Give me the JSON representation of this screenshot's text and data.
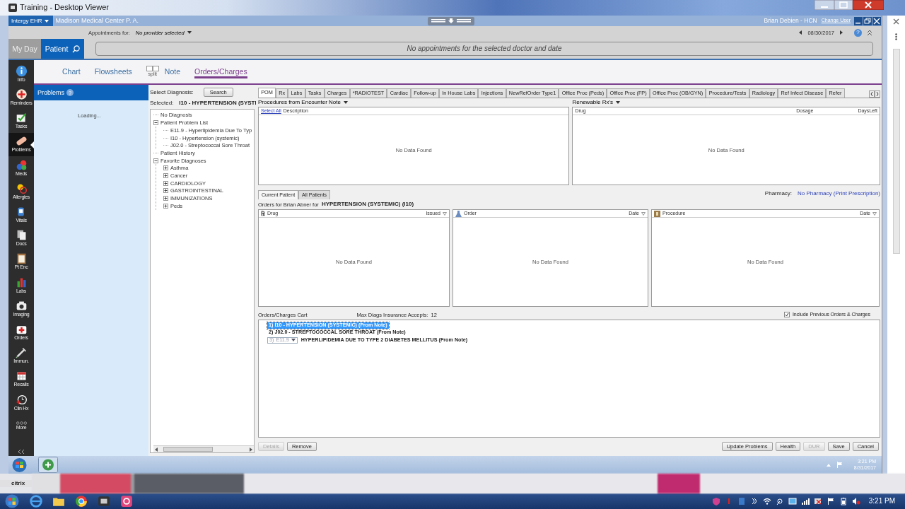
{
  "window": {
    "title": "Training - Desktop Viewer"
  },
  "app_bar": {
    "product": "Intergy EHR",
    "practice": "Madison Medical Center P. A.",
    "user": "Brian Debien - HCN",
    "change_user": "Change User"
  },
  "appointments": {
    "label": "Appointments for:",
    "provider": "No provider selected",
    "date": "08/30/2017",
    "help": "?",
    "message": "No appointments for the selected doctor and date"
  },
  "mode_tabs": [
    {
      "label": "My Day",
      "selected": false
    },
    {
      "label": "Patient",
      "selected": true
    }
  ],
  "sidebar": {
    "items": [
      {
        "label": "Info",
        "selected": false
      },
      {
        "label": "Reminders",
        "selected": false
      },
      {
        "label": "Tasks",
        "selected": false
      },
      {
        "label": "Problems",
        "selected": true
      },
      {
        "label": "Meds",
        "selected": false
      },
      {
        "label": "Allergies",
        "selected": false
      },
      {
        "label": "Vitals",
        "selected": false
      },
      {
        "label": "Docs",
        "selected": false
      },
      {
        "label": "Pt Enc",
        "selected": false
      },
      {
        "label": "Labs",
        "selected": false
      },
      {
        "label": "Imaging",
        "selected": false
      },
      {
        "label": "Orders",
        "selected": false
      },
      {
        "label": "Immun.",
        "selected": false
      },
      {
        "label": "Recalls",
        "selected": false
      },
      {
        "label": "Clin Hx",
        "selected": false
      },
      {
        "label": "More",
        "selected": false
      }
    ]
  },
  "view_tabs": [
    {
      "label": "Chart",
      "selected": false
    },
    {
      "label": "Flowsheets",
      "selected": false
    },
    {
      "kind": "split",
      "label": "split",
      "selected": false
    },
    {
      "label": "Note",
      "selected": false
    },
    {
      "label": "Orders/Charges",
      "selected": true
    }
  ],
  "problems": {
    "title": "Problems",
    "help": "?",
    "status": "Loading..."
  },
  "diagnosis": {
    "label": "Select Diagnosis:",
    "search_button": "Search",
    "selected_label": "Selected:",
    "selected_value": "I10 - HYPERTENSION (SYSTI",
    "tree": [
      {
        "label": "No Diagnosis"
      },
      {
        "label": "Patient Problem List",
        "expanded": true,
        "children": [
          {
            "label": "E11.9 - Hyperlipidemia Due To Typ"
          },
          {
            "label": "I10 - Hypertension (systemic)"
          },
          {
            "label": "J02.0 - Streptococcal Sore Throat"
          }
        ]
      },
      {
        "label": "Patient History"
      },
      {
        "label": "Favorite Diagnoses",
        "expanded": true,
        "children": [
          {
            "label": "Asthma",
            "expanded": false
          },
          {
            "label": "Cancer",
            "expanded": false
          },
          {
            "label": "CARDIOLOGY",
            "expanded": false
          },
          {
            "label": "GASTROINTESTINAL",
            "expanded": false
          },
          {
            "label": "IMMUNIZATIONS",
            "expanded": false
          },
          {
            "label": "Peds",
            "expanded": false
          }
        ]
      }
    ]
  },
  "order_tabs": [
    {
      "label": "POM",
      "selected": true
    },
    {
      "label": "Rx",
      "selected": false
    },
    {
      "label": "Labs",
      "selected": false
    },
    {
      "label": "Tasks",
      "selected": false
    },
    {
      "label": "Charges",
      "selected": false
    },
    {
      "label": "*RADIOTEST",
      "selected": false
    },
    {
      "label": "Cardiac",
      "selected": false
    },
    {
      "label": "Follow-up",
      "selected": false
    },
    {
      "label": "In House Labs",
      "selected": false
    },
    {
      "label": "Injections",
      "selected": false
    },
    {
      "label": "NewRefOrder Type1",
      "selected": false
    },
    {
      "label": "Office Proc  (Peds)",
      "selected": false
    },
    {
      "label": "Office Proc (FP)",
      "selected": false
    },
    {
      "label": "Office Proc (OB/GYN)",
      "selected": false
    },
    {
      "label": "Procedure/Tests",
      "selected": false
    },
    {
      "label": "Radiology",
      "selected": false
    },
    {
      "label": "Ref Infect Disease",
      "selected": false
    },
    {
      "label": "Refer",
      "selected": false
    }
  ],
  "procedures": {
    "title": "Procedures from Encounter Note",
    "select_all": "Select All",
    "column": "Description",
    "empty": "No Data Found"
  },
  "renewable": {
    "title": "Renewable Rx's",
    "columns": [
      "Drug",
      "Dosage",
      "DaysLeft"
    ],
    "empty": "No Data Found"
  },
  "patient_tabs": [
    {
      "label": "Current Patient",
      "selected": true
    },
    {
      "label": "All Patients",
      "selected": false
    }
  ],
  "pharmacy": {
    "label": "Pharmacy:",
    "value": "No Pharmacy (Print Prescription)"
  },
  "orders_for": {
    "prefix": "Orders for Brian Abner for",
    "diagnosis": "HYPERTENSION (SYSTEMIC) (I10)"
  },
  "order_grids": [
    {
      "kind": "drug",
      "glyph": "℞",
      "title": "Drug",
      "column": "Issued",
      "empty": "No Data Found"
    },
    {
      "kind": "order",
      "title": "Order",
      "column": "Date",
      "empty": "No Data Found"
    },
    {
      "kind": "procedure",
      "title": "Procedure",
      "column": "Date",
      "empty": "No Data Found"
    }
  ],
  "cart": {
    "title": "Orders/Charges Cart",
    "max_label": "Max Diags Insurance Accepts:",
    "max_value": "12",
    "include_previous": {
      "label": "Include Previous Orders & Charges",
      "checked": true
    },
    "items": [
      {
        "kind": "line",
        "text": "1) I10 - HYPERTENSION (SYSTEMIC) (From Note)",
        "selected": true
      },
      {
        "kind": "line",
        "text": "2) J02.0 - STREPTOCOCCAL SORE THROAT (From Note)",
        "selected": false
      },
      {
        "kind": "combo",
        "index": "3)",
        "code": "E11.9",
        "text": "HYPERLIPIDEMIA DUE TO TYPE 2 DIABETES MELLITUS (From Note)",
        "selected": false
      }
    ]
  },
  "buttons_left": [
    {
      "label": "Details",
      "disabled": true
    },
    {
      "label": "Remove",
      "disabled": false
    }
  ],
  "buttons_right": [
    {
      "label": "Update Problems",
      "disabled": false
    },
    {
      "label": "Health",
      "disabled": false
    },
    {
      "label": "DUR",
      "disabled": true
    },
    {
      "label": "Save",
      "disabled": false
    },
    {
      "label": "Cancel",
      "disabled": false
    }
  ],
  "citrix_bar": {
    "time": "3:21 PM",
    "date": "8/31/2017"
  },
  "citrix_logo": "citrix",
  "taskbar": {
    "time": "3:21 PM"
  }
}
